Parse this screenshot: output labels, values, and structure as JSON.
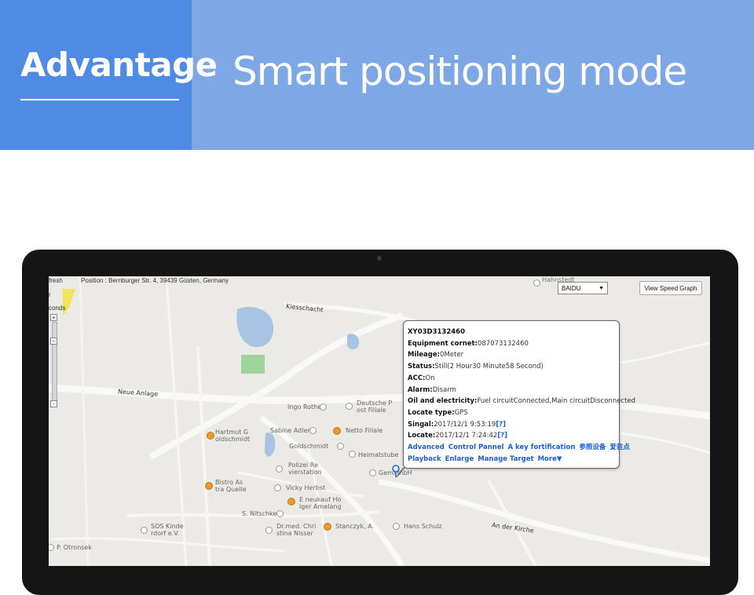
{
  "banner": {
    "label": "Advantage",
    "headline": "Smart positioning mode",
    "colors": {
      "left": "#4f8ae4",
      "right": "#7ea7e6"
    }
  },
  "screen": {
    "toolbar": {
      "refresh_label": "fresh",
      "position_text": "Position : Bernburger Str. 4, 39439 Güsten, Germany",
      "left_label": "r",
      "seconds_label": "conds",
      "map_select": "BAIDU",
      "speed_graph_button": "View Speed Graph"
    },
    "zoom": {
      "in": "+",
      "out": "-",
      "mid": "–"
    },
    "map": {
      "streets": {
        "kiesschacht": "Kiesschacht",
        "neue_anlage": "Neue Anlage",
        "an_der_kirche": "An der Kirche",
        "hahn": "Hahnstedt"
      },
      "pois": {
        "deutsche_post": [
          "Deutsche P",
          "ost Filiale"
        ],
        "ingo_rothe": "Ingo Rothe",
        "hartmut": [
          "Hartmut G",
          "oldschmidt"
        ],
        "sabine": "Sabine Adler",
        "netto": "Netto Filiale",
        "goldschmidt": "Goldschmidt",
        "heimatstube": "Heimatstube",
        "polizei": [
          "Polizei Re",
          "vierstation"
        ],
        "gemini": "Gemi   mbH",
        "bistro": [
          "Bistro As",
          "tra Quelle"
        ],
        "vicky": "Vicky Herbst",
        "neukauf": [
          "E neukauf Ho",
          "lger Amelang"
        ],
        "nitschke": "S. Nitschke",
        "sos": [
          "SOS Kinde",
          "rdorf e.V."
        ],
        "christina": [
          "Dr.med. Chri",
          "stina Nisser"
        ],
        "stanczyk": "Stanczyk, A.",
        "hans_schulz": "Hans Schulz",
        "otronsek": "P. Otronsek"
      }
    },
    "info": {
      "device_id": "XY03D3132460",
      "rows": [
        {
          "label": "Equipment cornet:",
          "value": "087073132460"
        },
        {
          "label": "Mileage:",
          "value": "0Meter"
        },
        {
          "label": "Status:",
          "value": "Still(2 Hour30 Minute58 Second)"
        },
        {
          "label": "ACC:",
          "value": "On"
        },
        {
          "label": "Alarm:",
          "value": "Disarm"
        },
        {
          "label": "Oil and electricity:",
          "value": "Fuel circuitConnected,Main circuitDisconnected"
        },
        {
          "label": "Locate type:",
          "value": "GPS"
        },
        {
          "label": "Singal:",
          "value": "2017/12/1 9:53:19",
          "suffix": "[?]"
        },
        {
          "label": "Locate:",
          "value": "2017/12/1 7:24:42",
          "suffix": "[?]"
        }
      ],
      "links_row1": [
        "Advanced",
        "Control Pannel",
        "A key fortification",
        "参照设备",
        "爱驻点"
      ],
      "links_row2": [
        "Playback",
        "Enlarge",
        "Manage Target",
        "More▼"
      ]
    }
  }
}
